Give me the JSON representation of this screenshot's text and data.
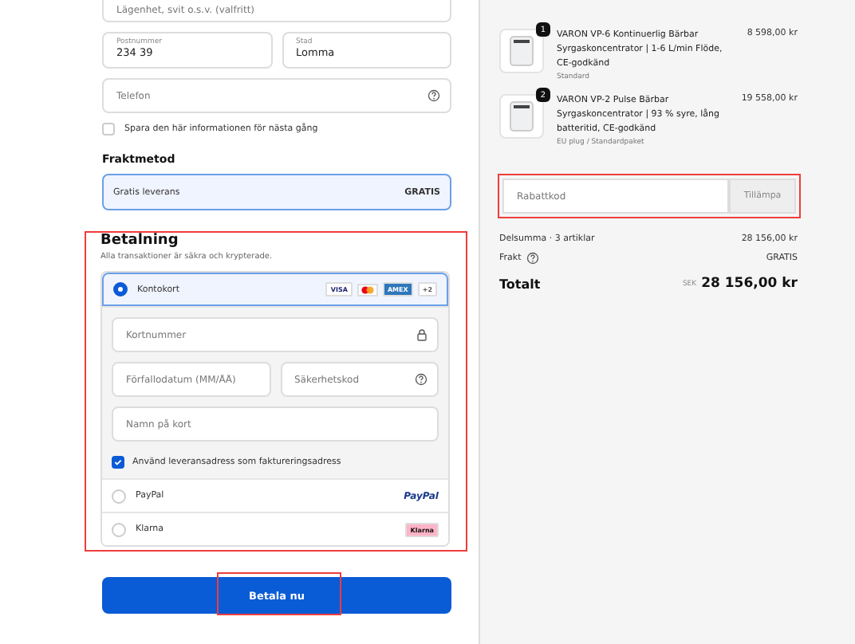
{
  "address": {
    "apartment": {
      "placeholder": "Lägenhet, svit o.s.v. (valfritt)"
    },
    "postal_code": {
      "label": "Postnummer",
      "value": "234 39"
    },
    "city": {
      "label": "Stad",
      "value": "Lomma"
    },
    "phone": {
      "placeholder": "Telefon"
    },
    "save_info": {
      "label": "Spara den här informationen för nästa gång",
      "checked": false
    }
  },
  "shipping": {
    "title": "Fraktmetod",
    "options": [
      {
        "label": "Gratis leverans",
        "price": "GRATIS",
        "selected": true
      }
    ]
  },
  "payment": {
    "title": "Betalning",
    "subtitle": "Alla transaktioner är säkra och krypterade.",
    "highlighted": true,
    "methods": [
      {
        "kind": "card",
        "label": "Kontokort",
        "selected": true,
        "logos": [
          {
            "kind": "visa",
            "text": "VISA"
          },
          {
            "kind": "mastercard"
          },
          {
            "kind": "amex",
            "text": "AMEX"
          },
          {
            "kind": "more",
            "text": "+2"
          }
        ]
      },
      {
        "kind": "paypal",
        "label": "PayPal",
        "selected": false,
        "logo": "PayPal"
      },
      {
        "kind": "klarna",
        "label": "Klarna",
        "selected": false,
        "logo": "Klarna"
      }
    ],
    "card": {
      "number": {
        "placeholder": "Kortnummer"
      },
      "expiry": {
        "placeholder": "Förfallodatum (MM/ÅÅ)"
      },
      "cvc": {
        "placeholder": "Säkerhetskod"
      },
      "name": {
        "placeholder": "Namn på kort"
      },
      "billing_same": {
        "label": "Använd leveransadress som faktureringsadress",
        "checked": true
      }
    }
  },
  "pay_button": {
    "label": "Betala nu",
    "highlighted": true
  },
  "cart": {
    "items": [
      {
        "quantity": "1",
        "name": "VARON VP-6 Kontinuerlig Bärbar Syrgaskoncentrator | 1-6 L/min Flöde, CE-godkänd",
        "variant": "Standard",
        "price": "8 598,00 kr"
      },
      {
        "quantity": "2",
        "name": "VARON VP-2 Pulse Bärbar Syrgaskoncentrator | 93 % syre, lång batteritid, CE-godkänd",
        "variant": "EU plug / Standardpaket",
        "price": "19 558,00 kr"
      }
    ],
    "discount": {
      "placeholder": "Rabattkod",
      "button": "Tillämpa",
      "highlighted": true
    },
    "subtotal": {
      "label": "Delsumma · 3 artiklar",
      "value": "28 156,00 kr"
    },
    "shipping": {
      "label": "Frakt",
      "value": "GRATIS"
    },
    "total": {
      "label": "Totalt",
      "currency": "SEK",
      "value": "28 156,00 kr"
    }
  }
}
